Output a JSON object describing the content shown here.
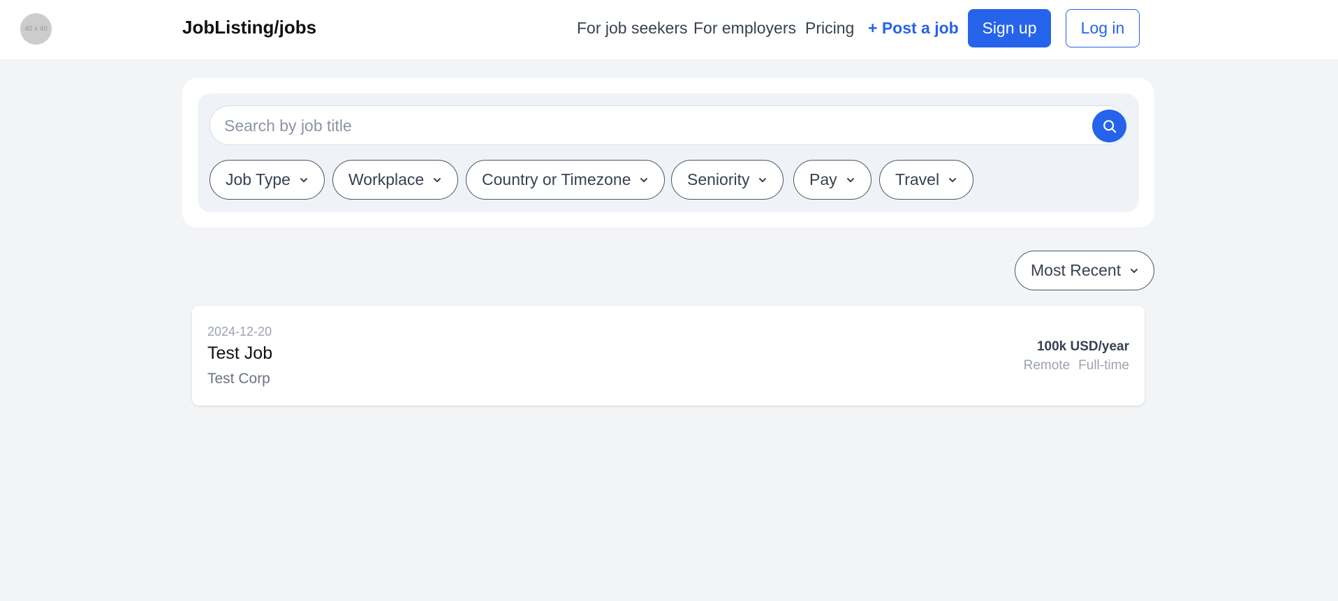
{
  "header": {
    "avatar_text": "40 x 40",
    "brand": "JobListing/jobs",
    "nav": {
      "job_seekers": "For job seekers",
      "employers": "For employers",
      "pricing": "Pricing",
      "post_job": "+ Post a job"
    },
    "signup": "Sign up",
    "login": "Log in"
  },
  "search": {
    "placeholder": "Search by job title",
    "value": "",
    "icon": "search-icon"
  },
  "filters": [
    {
      "label": "Job Type"
    },
    {
      "label": "Workplace"
    },
    {
      "label": "Country or Timezone"
    },
    {
      "label": "Seniority"
    },
    {
      "label": "Pay"
    },
    {
      "label": "Travel"
    }
  ],
  "sort": {
    "selected": "Most Recent"
  },
  "jobs": [
    {
      "date": "2024-12-20",
      "title": "Test Job",
      "company": "Test Corp",
      "pay": "100k USD/year",
      "tags": [
        "Remote",
        "Full-time"
      ]
    }
  ],
  "colors": {
    "accent": "#2563eb",
    "background": "#f3f4f6"
  }
}
